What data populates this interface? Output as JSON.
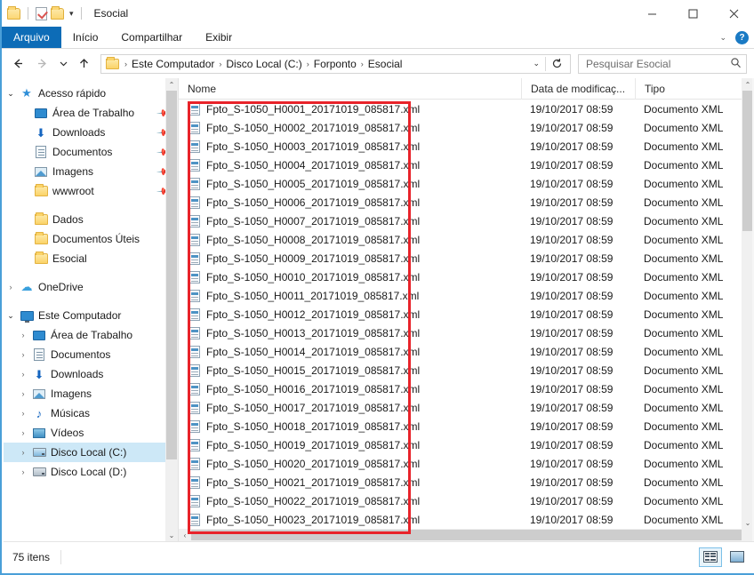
{
  "window": {
    "title": "Esocial",
    "quick_access": [
      {
        "name": "folder-icon",
        "label": "Folder"
      },
      {
        "name": "properties-icon",
        "label": "Propriedades"
      },
      {
        "name": "new-folder-icon",
        "label": "Nova pasta"
      }
    ],
    "qat_dropdown": "▾",
    "controls": {
      "minimize": "Minimizar",
      "maximize": "Maximizar",
      "close": "Fechar"
    }
  },
  "ribbon": {
    "tabs": [
      {
        "label": "Arquivo",
        "active": true
      },
      {
        "label": "Início",
        "active": false
      },
      {
        "label": "Compartilhar",
        "active": false
      },
      {
        "label": "Exibir",
        "active": false
      }
    ],
    "expand_chevron": "⌄",
    "help_label": "?"
  },
  "address": {
    "back": "←",
    "forward": "→",
    "recent_chevron": "⌄",
    "up": "↑",
    "crumbs": [
      "Este Computador",
      "Disco Local (C:)",
      "Forponto",
      "Esocial"
    ],
    "separator": "›",
    "dropdown": "⌄",
    "refresh": "↻"
  },
  "search": {
    "placeholder": "Pesquisar Esocial",
    "icon": "search-icon"
  },
  "sidebar": {
    "groups": [
      {
        "label": "Acesso rápido",
        "expander": "⌄",
        "icon": "star-icon",
        "indent": 0,
        "items": [
          {
            "label": "Área de Trabalho",
            "icon": "desktop-icon",
            "pinned": true
          },
          {
            "label": "Downloads",
            "icon": "download-icon",
            "pinned": true
          },
          {
            "label": "Documentos",
            "icon": "documents-icon",
            "pinned": true
          },
          {
            "label": "Imagens",
            "icon": "pictures-icon",
            "pinned": true
          },
          {
            "label": "wwwroot",
            "icon": "folder-icon",
            "pinned": true
          },
          {
            "label": "",
            "icon": "",
            "pinned": false,
            "spacer": true
          },
          {
            "label": "Dados",
            "icon": "folder-icon",
            "pinned": false
          },
          {
            "label": "Documentos Úteis",
            "icon": "folder-icon",
            "pinned": false
          },
          {
            "label": "Esocial",
            "icon": "folder-icon",
            "pinned": false
          }
        ]
      },
      {
        "label": "OneDrive",
        "expander": "›",
        "icon": "cloud-icon",
        "indent": 0,
        "items": []
      },
      {
        "label": "Este Computador",
        "expander": "⌄",
        "icon": "pc-icon",
        "indent": 0,
        "items": [
          {
            "label": "Área de Trabalho",
            "icon": "desktop-icon",
            "expander": "›"
          },
          {
            "label": "Documentos",
            "icon": "documents-icon",
            "expander": "›"
          },
          {
            "label": "Downloads",
            "icon": "download-icon",
            "expander": "›"
          },
          {
            "label": "Imagens",
            "icon": "pictures-icon",
            "expander": "›"
          },
          {
            "label": "Músicas",
            "icon": "music-icon",
            "expander": "›"
          },
          {
            "label": "Vídeos",
            "icon": "video-icon",
            "expander": "›"
          },
          {
            "label": "Disco Local (C:)",
            "icon": "drive-system-icon",
            "expander": "›",
            "selected": true
          },
          {
            "label": "Disco Local (D:)",
            "icon": "drive-icon",
            "expander": "›"
          }
        ]
      }
    ]
  },
  "columns": [
    {
      "label": "Nome",
      "sorted": true,
      "sort_mark": "⌃"
    },
    {
      "label": "Data de modificaç...",
      "sorted": false
    },
    {
      "label": "Tipo",
      "sorted": false
    }
  ],
  "files": [
    {
      "name": "Fpto_S-1050_H0001_20171019_085817.xml",
      "date": "19/10/2017 08:59",
      "type": "Documento XML"
    },
    {
      "name": "Fpto_S-1050_H0002_20171019_085817.xml",
      "date": "19/10/2017 08:59",
      "type": "Documento XML"
    },
    {
      "name": "Fpto_S-1050_H0003_20171019_085817.xml",
      "date": "19/10/2017 08:59",
      "type": "Documento XML"
    },
    {
      "name": "Fpto_S-1050_H0004_20171019_085817.xml",
      "date": "19/10/2017 08:59",
      "type": "Documento XML"
    },
    {
      "name": "Fpto_S-1050_H0005_20171019_085817.xml",
      "date": "19/10/2017 08:59",
      "type": "Documento XML"
    },
    {
      "name": "Fpto_S-1050_H0006_20171019_085817.xml",
      "date": "19/10/2017 08:59",
      "type": "Documento XML"
    },
    {
      "name": "Fpto_S-1050_H0007_20171019_085817.xml",
      "date": "19/10/2017 08:59",
      "type": "Documento XML"
    },
    {
      "name": "Fpto_S-1050_H0008_20171019_085817.xml",
      "date": "19/10/2017 08:59",
      "type": "Documento XML"
    },
    {
      "name": "Fpto_S-1050_H0009_20171019_085817.xml",
      "date": "19/10/2017 08:59",
      "type": "Documento XML"
    },
    {
      "name": "Fpto_S-1050_H0010_20171019_085817.xml",
      "date": "19/10/2017 08:59",
      "type": "Documento XML"
    },
    {
      "name": "Fpto_S-1050_H0011_20171019_085817.xml",
      "date": "19/10/2017 08:59",
      "type": "Documento XML"
    },
    {
      "name": "Fpto_S-1050_H0012_20171019_085817.xml",
      "date": "19/10/2017 08:59",
      "type": "Documento XML"
    },
    {
      "name": "Fpto_S-1050_H0013_20171019_085817.xml",
      "date": "19/10/2017 08:59",
      "type": "Documento XML"
    },
    {
      "name": "Fpto_S-1050_H0014_20171019_085817.xml",
      "date": "19/10/2017 08:59",
      "type": "Documento XML"
    },
    {
      "name": "Fpto_S-1050_H0015_20171019_085817.xml",
      "date": "19/10/2017 08:59",
      "type": "Documento XML"
    },
    {
      "name": "Fpto_S-1050_H0016_20171019_085817.xml",
      "date": "19/10/2017 08:59",
      "type": "Documento XML"
    },
    {
      "name": "Fpto_S-1050_H0017_20171019_085817.xml",
      "date": "19/10/2017 08:59",
      "type": "Documento XML"
    },
    {
      "name": "Fpto_S-1050_H0018_20171019_085817.xml",
      "date": "19/10/2017 08:59",
      "type": "Documento XML"
    },
    {
      "name": "Fpto_S-1050_H0019_20171019_085817.xml",
      "date": "19/10/2017 08:59",
      "type": "Documento XML"
    },
    {
      "name": "Fpto_S-1050_H0020_20171019_085817.xml",
      "date": "19/10/2017 08:59",
      "type": "Documento XML"
    },
    {
      "name": "Fpto_S-1050_H0021_20171019_085817.xml",
      "date": "19/10/2017 08:59",
      "type": "Documento XML"
    },
    {
      "name": "Fpto_S-1050_H0022_20171019_085817.xml",
      "date": "19/10/2017 08:59",
      "type": "Documento XML"
    },
    {
      "name": "Fpto_S-1050_H0023_20171019_085817.xml",
      "date": "19/10/2017 08:59",
      "type": "Documento XML"
    }
  ],
  "annotation": {
    "color": "#e8232a",
    "shape": "rectangle"
  },
  "statusbar": {
    "item_count": "75 itens",
    "views": [
      {
        "name": "details-view-button",
        "active": true
      },
      {
        "name": "large-icons-view-button",
        "active": false
      }
    ]
  },
  "scrollbars": {
    "up_arrow": "⌃",
    "down_arrow": "⌄",
    "left_arrow": "‹",
    "right_arrow": "›"
  }
}
